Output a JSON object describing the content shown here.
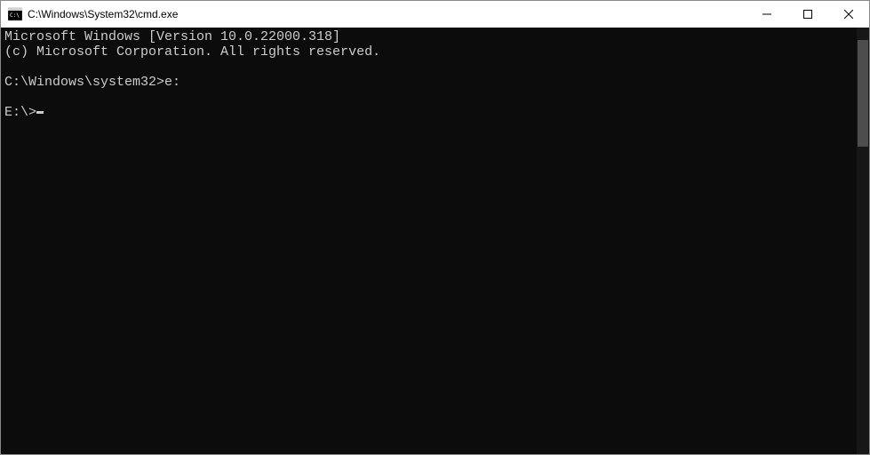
{
  "titlebar": {
    "title": "C:\\Windows\\System32\\cmd.exe"
  },
  "terminal": {
    "lines": {
      "header1": "Microsoft Windows [Version 10.0.22000.318]",
      "header2": "(c) Microsoft Corporation. All rights reserved.",
      "blank1": "",
      "prompt1_path": "C:\\Windows\\system32>",
      "prompt1_cmd": "e:",
      "blank2": "",
      "prompt2_path": "E:\\>"
    }
  }
}
